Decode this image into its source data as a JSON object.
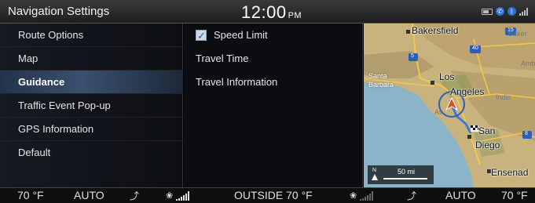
{
  "header": {
    "title": "Navigation Settings",
    "time": "12:00",
    "ampm": "PM"
  },
  "status": {
    "icons": [
      "battery-icon",
      "bluetooth-phone-icon",
      "bluetooth-icon",
      "signal-icon"
    ]
  },
  "menu": {
    "items": [
      {
        "label": "Route Options"
      },
      {
        "label": "Map"
      },
      {
        "label": "Guidance",
        "active": true
      },
      {
        "label": "Traffic Event Pop-up"
      },
      {
        "label": "GPS Information"
      },
      {
        "label": "Default"
      }
    ]
  },
  "options": {
    "speed_limit": {
      "label": "Speed Limit",
      "checked": true
    },
    "travel_time": "Travel Time",
    "travel_information": "Travel Information"
  },
  "map": {
    "labels": {
      "bakersfield": "Bakersfield",
      "baker": "Baker",
      "amb": "Amb",
      "santa_barbara_1": "Santa",
      "santa_barbara_2": "Barbara",
      "los_angeles_1": "Los",
      "los_angeles_2": "Angeles",
      "indio": "Indio",
      "av": "Av",
      "san": "San",
      "diego": "Diego",
      "ensenada": "Ensenad",
      "route_5": "5",
      "route_40": "40",
      "route_8": "8",
      "route_15": "15"
    },
    "scale_text": "50 mi",
    "compass": "N"
  },
  "climate": {
    "left_temp": "70 °F",
    "left_mode": "AUTO",
    "outside": "OUTSIDE  70 °F",
    "right_mode": "AUTO",
    "right_temp": "70 °F",
    "left_fan_level": 6,
    "right_fan_level": 0
  }
}
